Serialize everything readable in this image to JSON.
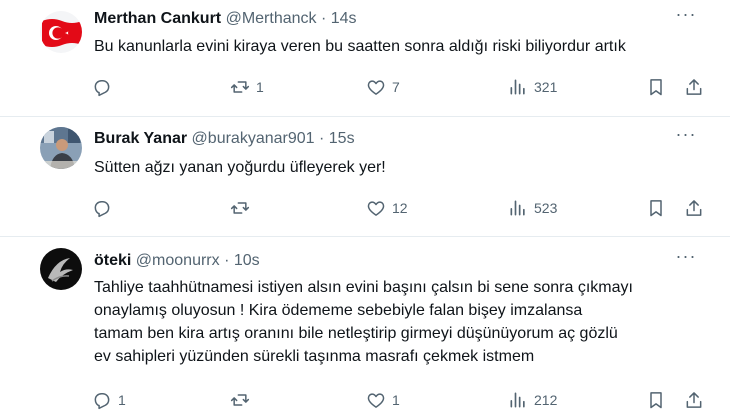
{
  "tweets": [
    {
      "name": "Merthan Cankurt",
      "handle": "@Merthanck",
      "dot": "·",
      "time": "14s",
      "text": "Bu kanunlarla evini kiraya veren bu saatten sonra aldığı riski biliyordur artık",
      "replies": "",
      "retweets": "1",
      "likes": "7",
      "views": "321",
      "avatar": "turkish-flag"
    },
    {
      "name": "Burak Yanar",
      "handle": "@burakyanar901",
      "dot": "·",
      "time": "15s",
      "text": "Sütten ağzı yanan yoğurdu üfleyerek yer!",
      "replies": "",
      "retweets": "",
      "likes": "12",
      "views": "523",
      "avatar": "person-photo"
    },
    {
      "name": "öteki",
      "handle": "@moonurrx",
      "dot": "·",
      "time": "10s",
      "text_lines": [
        "Tahliye taahhütnamesi istiyen alsın evini başını çalsın bi sene sonra çıkmayı",
        "onaylamış oluyosun ! Kira ödememe sebebiyle falan bişey imzalansa",
        "tamam ben kira artış oranını bile netleştirip girmeyi düşünüyorum aç gözlü",
        "ev sahipleri yüzünden sürekli taşınma masrafı çekmek istmem"
      ],
      "replies": "1",
      "retweets": "",
      "likes": "1",
      "views": "212",
      "avatar": "dark-abstract"
    }
  ],
  "colors": {
    "muted": "#536471",
    "text": "#0f1419",
    "divider": "#e6ecf0",
    "flag_red": "#e30a17"
  },
  "icons": [
    "more-icon",
    "reply-icon",
    "retweet-icon",
    "like-icon",
    "views-icon",
    "bookmark-icon",
    "share-icon"
  ]
}
